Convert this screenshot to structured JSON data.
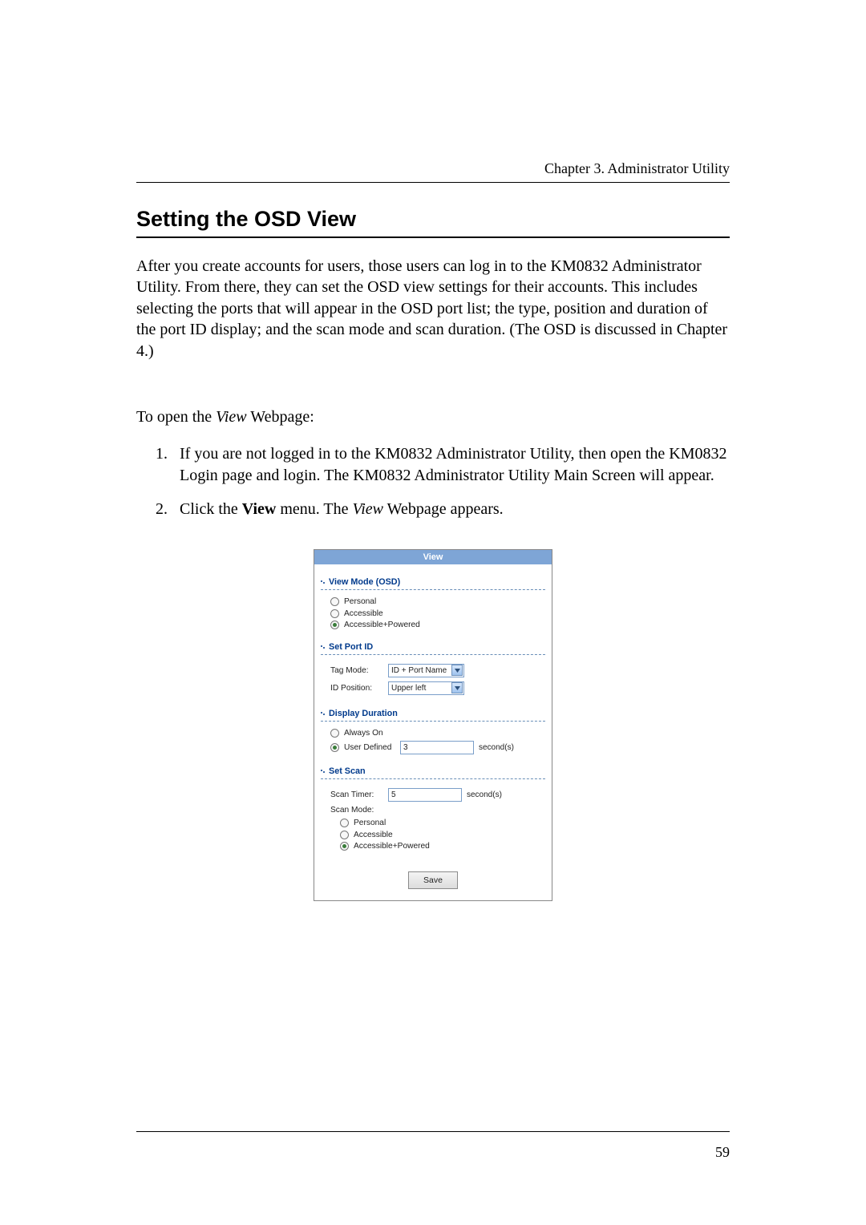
{
  "chapter_header": "Chapter 3. Administrator Utility",
  "section_title": "Setting the OSD View",
  "intro_paragraph": "After you create accounts for users, those users can log in to the KM0832 Administrator Utility. From there, they can set the OSD view settings for their accounts. This includes selecting the ports that will appear in the OSD port list; the type, position and duration of the port ID display; and the scan mode and scan duration. (The OSD is discussed in Chapter 4.)",
  "open_view_text_pre": "To open the ",
  "open_view_text_inner": "View",
  "open_view_text_post": " Webpage:",
  "steps": {
    "step1": "If you are not logged in to the KM0832 Administrator Utility, then open the KM0832 Login page and login. The KM0832 Administrator Utility Main Screen will appear.",
    "step2_pre": "Click the ",
    "step2_bold": "View",
    "step2_mid": " menu. The ",
    "step2_italic": "View",
    "step2_post": " Webpage appears."
  },
  "shot": {
    "title": "View",
    "groups": {
      "view_mode": {
        "title": "View Mode (OSD)",
        "options": [
          "Personal",
          "Accessible",
          "Accessible+Powered"
        ],
        "selected_index": 2
      },
      "set_port_id": {
        "title": "Set Port ID",
        "tag_mode_label": "Tag Mode:",
        "tag_mode_value": "ID + Port Name",
        "id_position_label": "ID Position:",
        "id_position_value": "Upper left"
      },
      "display_duration": {
        "title": "Display Duration",
        "options": [
          "Always On",
          "User Defined"
        ],
        "selected_index": 1,
        "user_defined_value": "3",
        "unit": "second(s)"
      },
      "set_scan": {
        "title": "Set Scan",
        "scan_timer_label": "Scan Timer:",
        "scan_timer_value": "5",
        "scan_timer_unit": "second(s)",
        "scan_mode_label": "Scan Mode:",
        "options": [
          "Personal",
          "Accessible",
          "Accessible+Powered"
        ],
        "selected_index": 2
      }
    },
    "save_label": "Save"
  },
  "page_number": "59"
}
